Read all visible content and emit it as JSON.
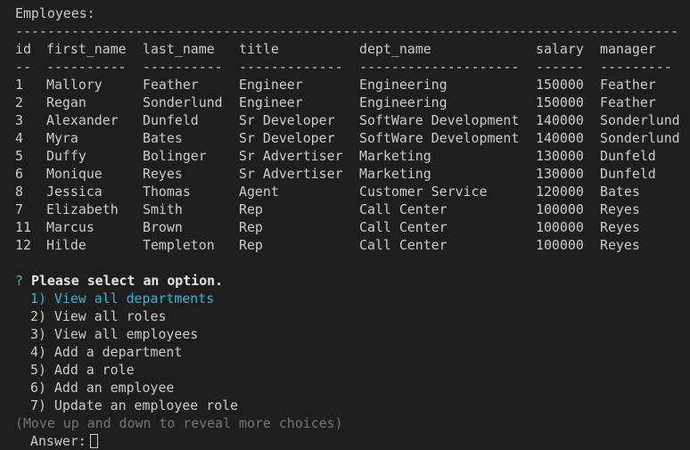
{
  "header": "Employees:",
  "rule": "-----------------------------------------------------------------------------------",
  "columns": {
    "id": "id",
    "first_name": "first_name",
    "last_name": "last_name",
    "title": "title",
    "dept_name": "dept_name",
    "salary": "salary",
    "manager": "manager"
  },
  "underlines": {
    "id": "--",
    "first_name": "----------",
    "last_name": "----------",
    "title": "-------------",
    "dept_name": "--------------------",
    "salary": "------",
    "manager": "---------"
  },
  "rows": [
    {
      "id": "1",
      "first_name": "Mallory",
      "last_name": "Feather",
      "title": "Engineer",
      "dept_name": "Engineering",
      "salary": "150000",
      "manager": "Feather"
    },
    {
      "id": "2",
      "first_name": "Regan",
      "last_name": "Sonderlund",
      "title": "Engineer",
      "dept_name": "Engineering",
      "salary": "150000",
      "manager": "Feather"
    },
    {
      "id": "3",
      "first_name": "Alexander",
      "last_name": "Dunfeld",
      "title": "Sr Developer",
      "dept_name": "SoftWare Development",
      "salary": "140000",
      "manager": "Sonderlund"
    },
    {
      "id": "4",
      "first_name": "Myra",
      "last_name": "Bates",
      "title": "Sr Developer",
      "dept_name": "SoftWare Development",
      "salary": "140000",
      "manager": "Sonderlund"
    },
    {
      "id": "5",
      "first_name": "Duffy",
      "last_name": "Bolinger",
      "title": "Sr Advertiser",
      "dept_name": "Marketing",
      "salary": "130000",
      "manager": "Dunfeld"
    },
    {
      "id": "6",
      "first_name": "Monique",
      "last_name": "Reyes",
      "title": "Sr Advertiser",
      "dept_name": "Marketing",
      "salary": "130000",
      "manager": "Dunfeld"
    },
    {
      "id": "8",
      "first_name": "Jessica",
      "last_name": "Thomas",
      "title": "Agent",
      "dept_name": "Customer Service",
      "salary": "120000",
      "manager": "Bates"
    },
    {
      "id": "7",
      "first_name": "Elizabeth",
      "last_name": "Smith",
      "title": "Rep",
      "dept_name": "Call Center",
      "salary": "100000",
      "manager": "Reyes"
    },
    {
      "id": "11",
      "first_name": "Marcus",
      "last_name": "Brown",
      "title": "Rep",
      "dept_name": "Call Center",
      "salary": "100000",
      "manager": "Reyes"
    },
    {
      "id": "12",
      "first_name": "Hilde",
      "last_name": "Templeton",
      "title": "Rep",
      "dept_name": "Call Center",
      "salary": "100000",
      "manager": "Reyes"
    }
  ],
  "prompt": {
    "mark": "?",
    "question": "Please select an option.",
    "choices": [
      "1) View all departments",
      "2) View all roles",
      "3) View all employees",
      "4) Add a department",
      "5) Add a role",
      "6) Add an employee",
      "7) Update an employee role"
    ],
    "selected_index": 0,
    "hint": "(Move up and down to reveal more choices)",
    "answer_label": "Answer:"
  },
  "colors": {
    "background": "#1e1e1e",
    "text": "#cccccc",
    "prompt_mark": "#23d18b",
    "selected_choice": "#29b8db",
    "hint": "#767676"
  }
}
